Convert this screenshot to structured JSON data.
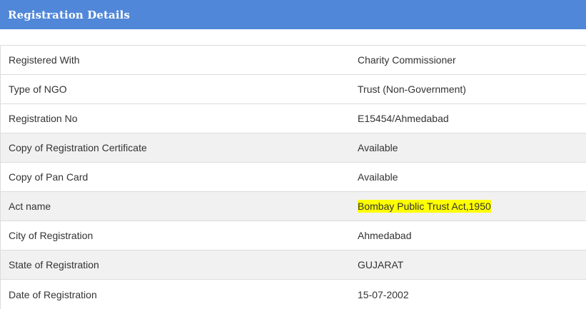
{
  "header": {
    "title": "Registration Details"
  },
  "rows": [
    {
      "label": "Registered With",
      "value": "Charity Commissioner"
    },
    {
      "label": "Type of NGO",
      "value": "Trust (Non-Government)"
    },
    {
      "label": "Registration No",
      "value": "E15454/Ahmedabad"
    },
    {
      "label": "Copy of Registration Certificate",
      "value": "Available"
    },
    {
      "label": "Copy of Pan Card",
      "value": "Available"
    },
    {
      "label": "Act name",
      "value": "Bombay Public Trust Act,1950"
    },
    {
      "label": "City of Registration",
      "value": "Ahmedabad"
    },
    {
      "label": "State of Registration",
      "value": "GUJARAT"
    },
    {
      "label": "Date of Registration",
      "value": "15-07-2002"
    }
  ],
  "colors": {
    "header_bg": "#5087d8",
    "highlight": "#ffff00",
    "alt_row": "#f1f1f1"
  }
}
